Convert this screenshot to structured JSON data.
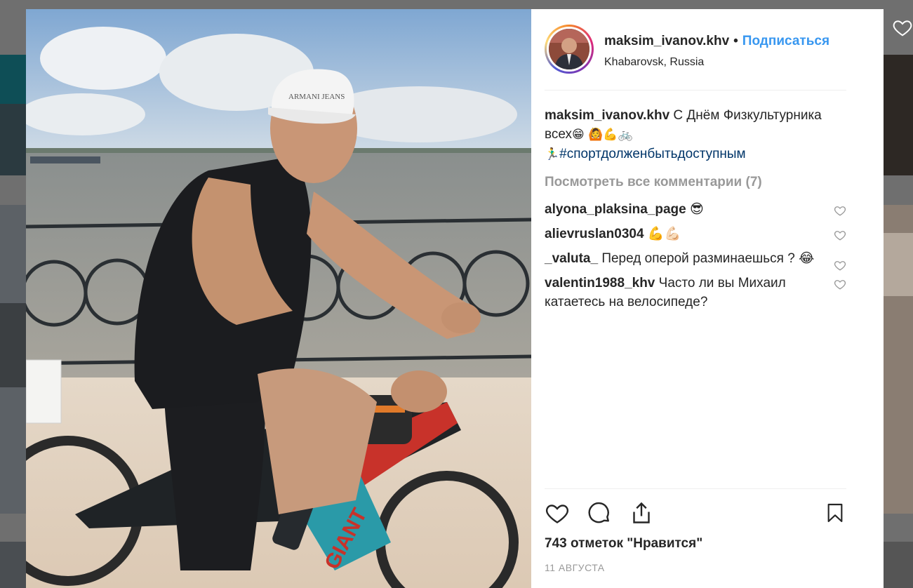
{
  "post": {
    "username": "maksim_ivanov.khv",
    "separator": "•",
    "follow_label": "Подписаться",
    "location": "Khabarovsk, Russia",
    "caption_user": "maksim_ivanov.khv",
    "caption_text": " С Днём Физкультурника всех",
    "caption_emojis": "😁 🙆💪🚲",
    "caption_runner": "🏃‍♂️",
    "hashtag": "#спортдолженбытьдоступным",
    "view_all_comments": "Посмотреть все комментарии (7)",
    "comments": [
      {
        "user": "alyona_plaksina_page",
        "text": " 😎"
      },
      {
        "user": "alievruslan0304",
        "text": " 💪💪🏻"
      },
      {
        "user": "_valuta_",
        "text": " Перед оперой разминаешься ? 😂"
      },
      {
        "user": "valentin1988_khv",
        "text": " Часто ли вы Михаил катаетесь на велосипеде?"
      }
    ],
    "likes": "743 отметок \"Нравится\"",
    "date": "11 АВГУСТА",
    "photo_texts": {
      "cap_brand": "ARMANI JEANS",
      "bike_brand": "GIANT"
    }
  },
  "icons": [
    "heart-icon",
    "comment-icon",
    "share-icon",
    "bookmark-icon"
  ],
  "colors": {
    "follow": "#3897f0",
    "hashtag": "#003569",
    "muted": "#999999",
    "text": "#262626"
  }
}
